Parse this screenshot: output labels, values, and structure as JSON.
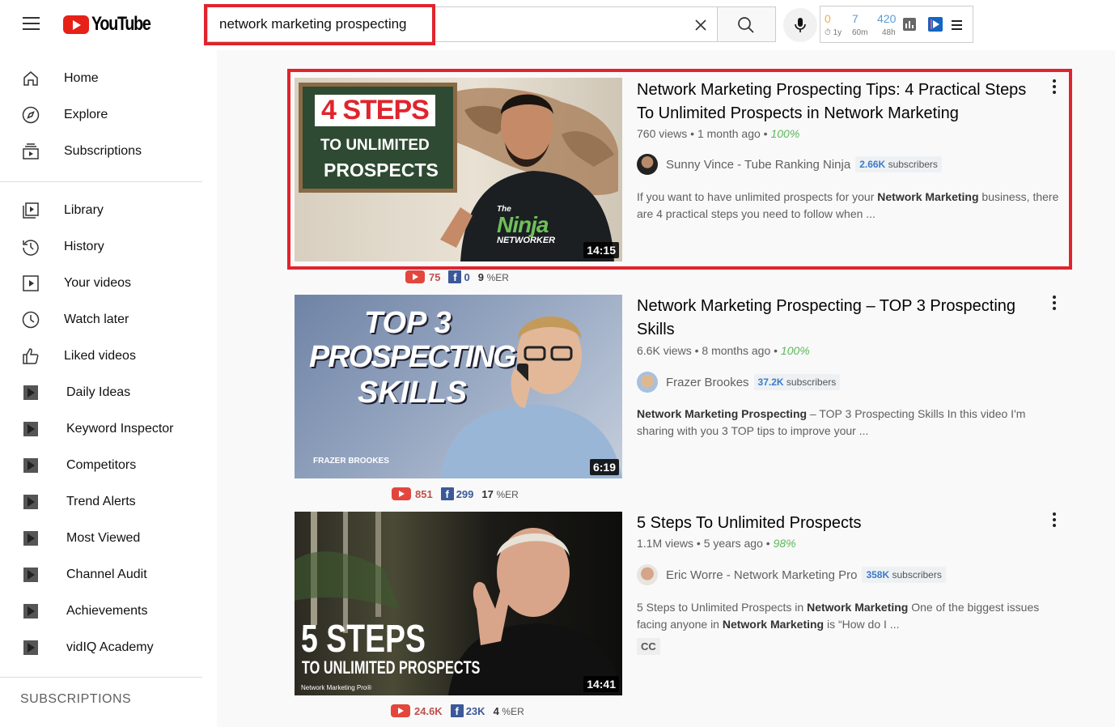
{
  "header": {
    "logo_text": "YouTube",
    "search_value": "network marketing prospecting",
    "vidiq": {
      "a": "0",
      "a_lbl": "1y",
      "b": "7",
      "b_lbl": "60m",
      "c": "420",
      "c_lbl": "48h"
    }
  },
  "sidebar": {
    "items": [
      {
        "label": "Home",
        "icon": "home-icon"
      },
      {
        "label": "Explore",
        "icon": "compass-icon"
      },
      {
        "label": "Subscriptions",
        "icon": "subscriptions-icon"
      },
      {
        "label": "Library",
        "icon": "library-icon"
      },
      {
        "label": "History",
        "icon": "history-icon"
      },
      {
        "label": "Your videos",
        "icon": "your-videos-icon"
      },
      {
        "label": "Watch later",
        "icon": "clock-icon"
      },
      {
        "label": "Liked videos",
        "icon": "thumbs-up-icon"
      },
      {
        "label": "Daily Ideas",
        "icon": "vidiq-icon"
      },
      {
        "label": "Keyword Inspector",
        "icon": "vidiq-icon"
      },
      {
        "label": "Competitors",
        "icon": "vidiq-icon"
      },
      {
        "label": "Trend Alerts",
        "icon": "vidiq-icon"
      },
      {
        "label": "Most Viewed",
        "icon": "vidiq-icon"
      },
      {
        "label": "Channel Audit",
        "icon": "vidiq-icon"
      },
      {
        "label": "Achievements",
        "icon": "vidiq-icon"
      },
      {
        "label": "vidIQ Academy",
        "icon": "vidiq-icon"
      }
    ],
    "subscriptions_heading": "SUBSCRIPTIONS"
  },
  "results": [
    {
      "title": "Network Marketing Prospecting Tips: 4 Practical Steps To Unlimited Prospects in Network Marketing",
      "views": "760 views",
      "age": "1 month ago",
      "score": "100%",
      "channel": "Sunny Vince - Tube Ranking Ninja",
      "subs_count": "2.66K",
      "subs_word": "subscribers",
      "desc_pre": "If you want to have unlimited prospects for your ",
      "desc_bold": "Network Marketing",
      "desc_post": " business, there are 4 practical steps you need to follow when ...",
      "duration": "14:15",
      "thumb_text1": "4 STEPS",
      "thumb_text2": "TO UNLIMITED",
      "thumb_text3": "PROSPECTS",
      "thumb_shirt1": "The",
      "thumb_shirt2": "Ninja",
      "thumb_shirt3": "NETWORKER",
      "stats": {
        "yt": "75",
        "fb": "0",
        "er": "9",
        "er_unit": "%ER"
      }
    },
    {
      "title": "Network Marketing Prospecting – TOP 3 Prospecting Skills",
      "views": "6.6K views",
      "age": "8 months ago",
      "score": "100%",
      "channel": "Frazer Brookes",
      "subs_count": "37.2K",
      "subs_word": "subscribers",
      "desc_bold": "Network Marketing Prospecting",
      "desc_post": " – TOP 3 Prospecting Skills In this video I'm sharing with you 3 TOP tips to improve your ...",
      "duration": "6:19",
      "thumb_text1": "TOP 3",
      "thumb_text2": "PROSPECTING",
      "thumb_text3": "SKILLS",
      "thumb_credit": "FRAZER BROOKES",
      "stats": {
        "yt": "851",
        "fb": "299",
        "er": "17",
        "er_unit": "%ER"
      }
    },
    {
      "title": "5 Steps To Unlimited Prospects",
      "views": "1.1M views",
      "age": "5 years ago",
      "score": "98%",
      "channel": "Eric Worre - Network Marketing Pro",
      "subs_count": "358K",
      "subs_word": "subscribers",
      "desc_pre": "5 Steps to Unlimited Prospects in ",
      "desc_bold": "Network Marketing",
      "desc_mid": " One of the biggest issues facing anyone in ",
      "desc_bold2": "Network Marketing",
      "desc_post": " is “How do I ...",
      "cc": "CC",
      "duration": "14:41",
      "thumb_text1": "5 STEPS",
      "thumb_text2": "TO UNLIMITED PROSPECTS",
      "thumb_credit": "Network Marketing Pro®",
      "stats": {
        "yt": "24.6K",
        "fb": "23K",
        "er": "4",
        "er_unit": "%ER"
      }
    }
  ],
  "colors": {
    "brand_red": "#ff0000",
    "highlight_red": "#e0242d",
    "score_green": "#5cb85c",
    "subs_blue": "#3c7ac8",
    "facebook_blue": "#3b5998"
  }
}
